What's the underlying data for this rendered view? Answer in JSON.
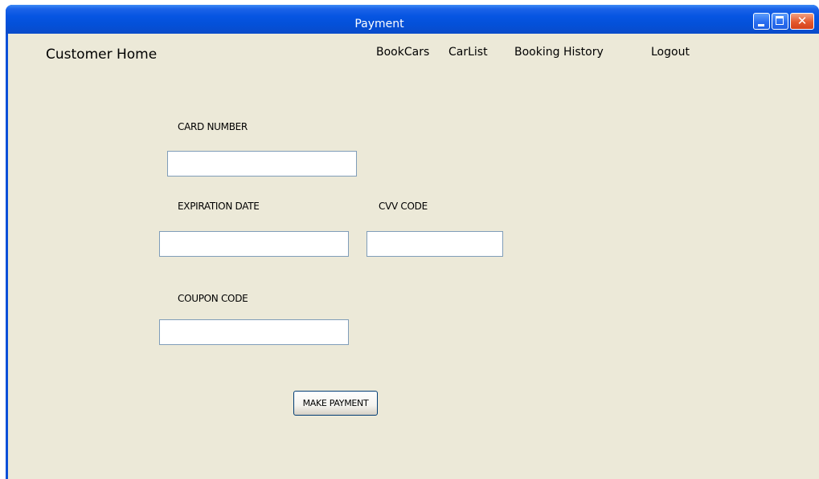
{
  "window": {
    "title": "Payment"
  },
  "title_buttons": {
    "minimize_icon": "minimize-icon",
    "maximize_icon": "maximize-icon",
    "close_icon": "close-icon",
    "close_glyph": "✕"
  },
  "menu": {
    "home": "Customer Home",
    "book_cars": "BookCars",
    "car_list": "CarList",
    "booking_history": "Booking History",
    "logout": "Logout"
  },
  "form": {
    "card_number_label": "CARD NUMBER",
    "card_number_value": "",
    "expiration_label": "EXPIRATION DATE",
    "expiration_value": "",
    "cvv_label": "CVV CODE",
    "cvv_value": "",
    "coupon_label": "COUPON CODE",
    "coupon_value": "",
    "submit_label": "MAKE PAYMENT"
  },
  "colors": {
    "titlebar": "#0655e2",
    "client_background": "#ece9d8",
    "field_border": "#7f9db9",
    "close_button": "#e4582d"
  }
}
